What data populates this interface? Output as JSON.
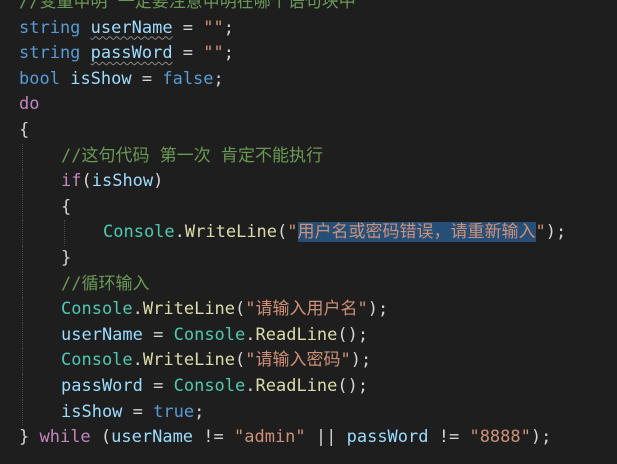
{
  "editor": {
    "lines": [
      {
        "id": "comment-top",
        "indent": 0,
        "tokens": [
          {
            "t": "//变量申明 一定要注意申明在哪个语句块中",
            "c": "cmt"
          }
        ]
      },
      {
        "id": "decl-username",
        "indent": 0,
        "tokens": [
          {
            "t": "string",
            "c": "kw"
          },
          {
            "t": " "
          },
          {
            "t": "userName",
            "c": "var",
            "squig": true
          },
          {
            "t": " = ",
            "c": "op"
          },
          {
            "t": "\"\"",
            "c": "str"
          },
          {
            "t": ";",
            "c": "op"
          }
        ]
      },
      {
        "id": "decl-password",
        "indent": 0,
        "tokens": [
          {
            "t": "string",
            "c": "kw"
          },
          {
            "t": " "
          },
          {
            "t": "passWord",
            "c": "var",
            "squig": true
          },
          {
            "t": " = ",
            "c": "op"
          },
          {
            "t": "\"\"",
            "c": "str"
          },
          {
            "t": ";",
            "c": "op"
          }
        ]
      },
      {
        "id": "decl-isshow",
        "indent": 0,
        "tokens": [
          {
            "t": "bool",
            "c": "kw"
          },
          {
            "t": " "
          },
          {
            "t": "isShow",
            "c": "var"
          },
          {
            "t": " = ",
            "c": "op"
          },
          {
            "t": "false",
            "c": "kw"
          },
          {
            "t": ";",
            "c": "op"
          }
        ]
      },
      {
        "id": "do-keyword",
        "indent": 0,
        "tokens": [
          {
            "t": "do",
            "c": "ctl"
          }
        ]
      },
      {
        "id": "open-brace-do",
        "indent": 0,
        "tokens": [
          {
            "t": "{",
            "c": "op"
          }
        ]
      },
      {
        "id": "comment-first-time",
        "indent": 1,
        "tokens": [
          {
            "t": "//这句代码 第一次 肯定不能执行",
            "c": "cmt"
          }
        ]
      },
      {
        "id": "if-isshow",
        "indent": 1,
        "tokens": [
          {
            "t": "if",
            "c": "ctl"
          },
          {
            "t": "(",
            "c": "op"
          },
          {
            "t": "isShow",
            "c": "var"
          },
          {
            "t": ")",
            "c": "op"
          }
        ]
      },
      {
        "id": "open-brace-if",
        "indent": 1,
        "tokens": [
          {
            "t": "{",
            "c": "op"
          }
        ]
      },
      {
        "id": "writeline-error",
        "indent": 2,
        "tokens": [
          {
            "t": "Console",
            "c": "type"
          },
          {
            "t": ".",
            "c": "op"
          },
          {
            "t": "WriteLine",
            "c": "fn"
          },
          {
            "t": "(",
            "c": "op"
          },
          {
            "t": "\"",
            "c": "str"
          },
          {
            "t": "用户名或密码错误，请重新输入",
            "c": "str",
            "sel": true
          },
          {
            "t": "\"",
            "c": "str"
          },
          {
            "t": ");",
            "c": "op"
          }
        ]
      },
      {
        "id": "close-brace-if",
        "indent": 1,
        "tokens": [
          {
            "t": "}",
            "c": "op"
          }
        ]
      },
      {
        "id": "comment-loop-input",
        "indent": 1,
        "tokens": [
          {
            "t": "//循环输入",
            "c": "cmt"
          }
        ]
      },
      {
        "id": "writeline-username-prompt",
        "indent": 1,
        "tokens": [
          {
            "t": "Console",
            "c": "type"
          },
          {
            "t": ".",
            "c": "op"
          },
          {
            "t": "WriteLine",
            "c": "fn"
          },
          {
            "t": "(",
            "c": "op"
          },
          {
            "t": "\"请输入用户名\"",
            "c": "str"
          },
          {
            "t": ");",
            "c": "op"
          }
        ]
      },
      {
        "id": "readline-username",
        "indent": 1,
        "tokens": [
          {
            "t": "userName",
            "c": "var"
          },
          {
            "t": " = ",
            "c": "op"
          },
          {
            "t": "Console",
            "c": "type"
          },
          {
            "t": ".",
            "c": "op"
          },
          {
            "t": "ReadLine",
            "c": "fn"
          },
          {
            "t": "();",
            "c": "op"
          }
        ]
      },
      {
        "id": "writeline-password-prompt",
        "indent": 1,
        "tokens": [
          {
            "t": "Console",
            "c": "type"
          },
          {
            "t": ".",
            "c": "op"
          },
          {
            "t": "WriteLine",
            "c": "fn"
          },
          {
            "t": "(",
            "c": "op"
          },
          {
            "t": "\"请输入密码\"",
            "c": "str"
          },
          {
            "t": ");",
            "c": "op"
          }
        ]
      },
      {
        "id": "readline-password",
        "indent": 1,
        "tokens": [
          {
            "t": "passWord",
            "c": "var"
          },
          {
            "t": " = ",
            "c": "op"
          },
          {
            "t": "Console",
            "c": "type"
          },
          {
            "t": ".",
            "c": "op"
          },
          {
            "t": "ReadLine",
            "c": "fn"
          },
          {
            "t": "();",
            "c": "op"
          }
        ]
      },
      {
        "id": "assign-isshow-true",
        "indent": 1,
        "tokens": [
          {
            "t": "isShow",
            "c": "var"
          },
          {
            "t": " = ",
            "c": "op"
          },
          {
            "t": "true",
            "c": "kw"
          },
          {
            "t": ";",
            "c": "op"
          }
        ]
      },
      {
        "id": "while-condition",
        "indent": 0,
        "tokens": [
          {
            "t": "} ",
            "c": "op"
          },
          {
            "t": "while",
            "c": "ctl"
          },
          {
            "t": " (",
            "c": "op"
          },
          {
            "t": "userName",
            "c": "var"
          },
          {
            "t": " != ",
            "c": "op"
          },
          {
            "t": "\"admin\"",
            "c": "str"
          },
          {
            "t": " || ",
            "c": "op"
          },
          {
            "t": "passWord",
            "c": "var"
          },
          {
            "t": " != ",
            "c": "op"
          },
          {
            "t": "\"8888\"",
            "c": "str"
          },
          {
            "t": ");",
            "c": "op"
          }
        ]
      }
    ]
  }
}
